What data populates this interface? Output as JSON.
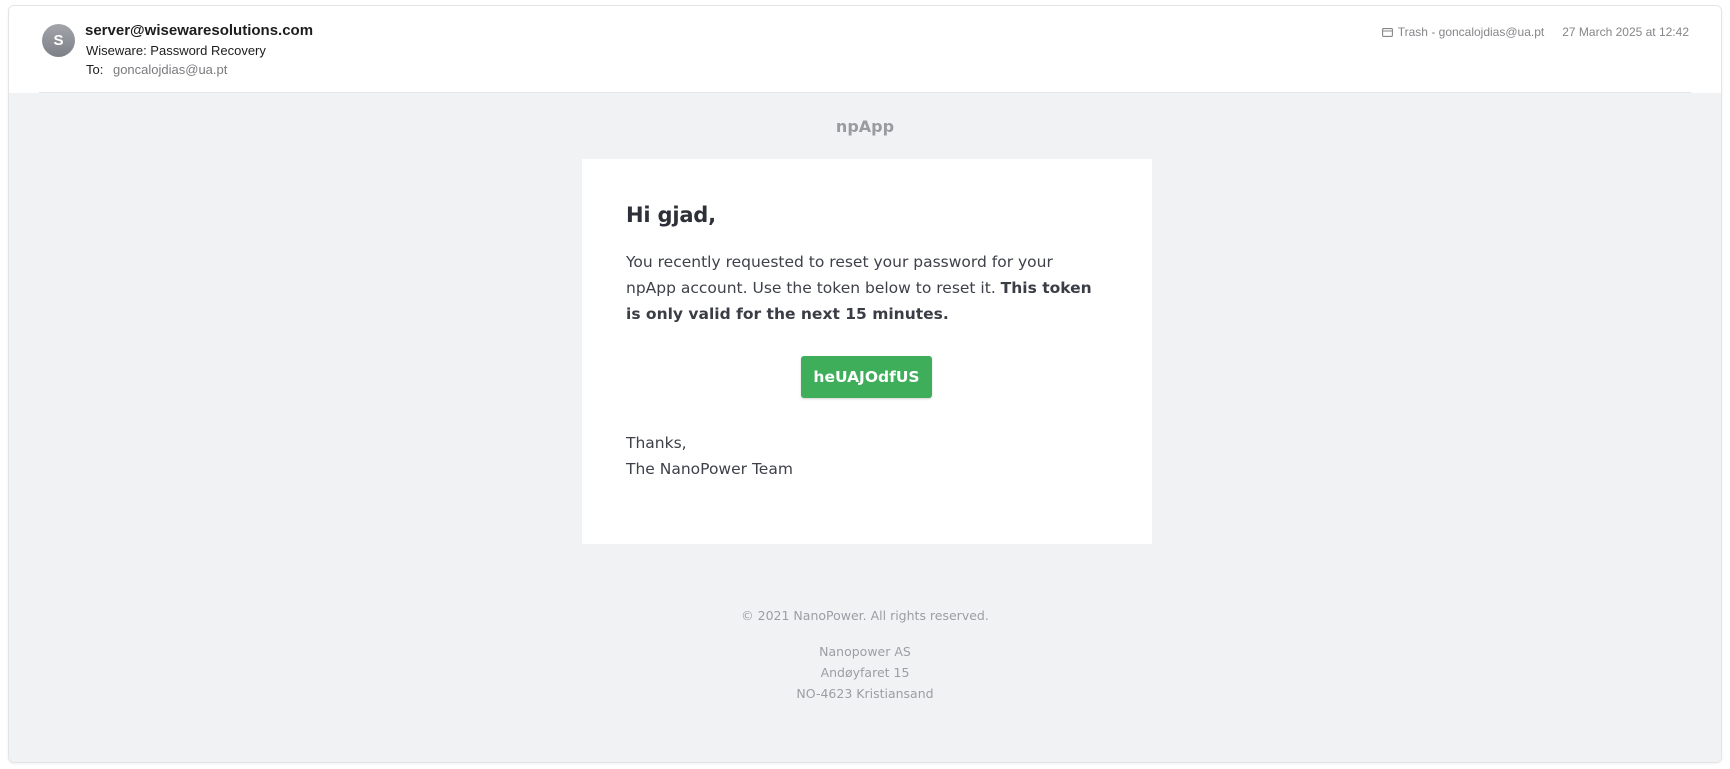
{
  "header": {
    "avatar_initial": "S",
    "sender": "server@wisewaresolutions.com",
    "subject": "Wiseware: Password Recovery",
    "to_label": "To:",
    "to_address": "goncalojdias@ua.pt",
    "mailbox": "Trash - goncalojdias@ua.pt",
    "date": "27 March 2025 at 12:42",
    "folder_icon": "tray-folder-icon"
  },
  "email": {
    "brand": "npApp",
    "greeting": "Hi gjad,",
    "message_plain": "You recently requested to reset your password for your npApp account. Use the token below to reset it. ",
    "message_bold": "This token is only valid for the next 15 minutes.",
    "token": "heUAJOdfUS",
    "signoff_line1": "Thanks,",
    "signoff_line2": "The NanoPower Team",
    "accent_color": "#3fae5b"
  },
  "footer": {
    "copyright": "© 2021 NanoPower. All rights reserved.",
    "company": "Nanopower AS",
    "street": "Andøyfaret 15",
    "city": "NO-4623 Kristiansand"
  }
}
